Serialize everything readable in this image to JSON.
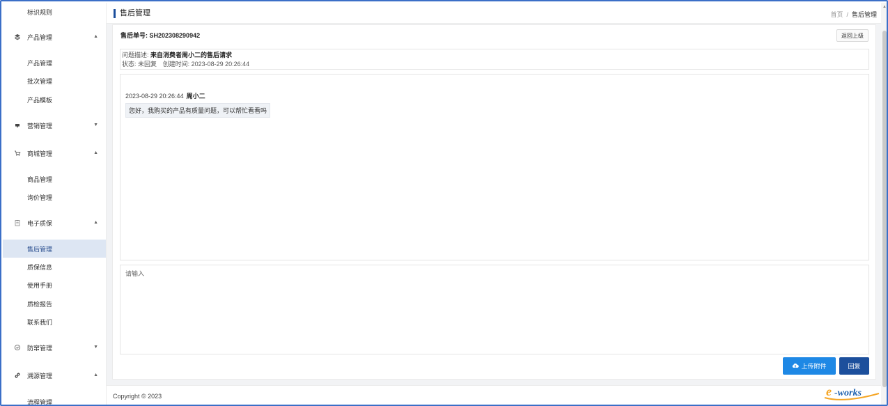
{
  "sidebar": {
    "items": [
      {
        "label": "标识规则",
        "kind": "sub"
      },
      {
        "label": "产品管理",
        "kind": "group",
        "icon": "layers-icon",
        "arrow": "▲"
      },
      {
        "label": "产品管理",
        "kind": "sub"
      },
      {
        "label": "批次管理",
        "kind": "sub"
      },
      {
        "label": "产品模板",
        "kind": "sub"
      },
      {
        "label": "营销管理",
        "kind": "group",
        "icon": "monitor-icon",
        "arrow": "▼"
      },
      {
        "label": "商城管理",
        "kind": "group",
        "icon": "cart-icon",
        "arrow": "▲"
      },
      {
        "label": "商品管理",
        "kind": "sub"
      },
      {
        "label": "询价管理",
        "kind": "sub"
      },
      {
        "label": "电子质保",
        "kind": "group",
        "icon": "clipboard-icon",
        "arrow": "▲"
      },
      {
        "label": "售后管理",
        "kind": "sub",
        "active": true
      },
      {
        "label": "质保信息",
        "kind": "sub"
      },
      {
        "label": "使用手册",
        "kind": "sub"
      },
      {
        "label": "质检报告",
        "kind": "sub"
      },
      {
        "label": "联系我们",
        "kind": "sub"
      },
      {
        "label": "防窜管理",
        "kind": "group",
        "icon": "shield-icon",
        "arrow": "▼"
      },
      {
        "label": "溯源管理",
        "kind": "group",
        "icon": "link-icon",
        "arrow": "▲"
      },
      {
        "label": "流程管理",
        "kind": "sub"
      }
    ]
  },
  "header": {
    "title": "售后管理",
    "breadcrumb": {
      "home": "首页",
      "separator": "/",
      "current": "售后管理"
    }
  },
  "detail": {
    "order_label": "售后单号:",
    "order_no": "SH202308290942",
    "back_label": "返回上级",
    "desc_label": "问题描述:",
    "desc_value": "来自消费者周小二的售后请求",
    "status_label": "状态:",
    "status_value": "未回复",
    "created_label": "创建时间:",
    "created_value": "2023-08-29 20:26:44"
  },
  "messages": [
    {
      "time": "2023-08-29 20:26:44",
      "author": "周小二",
      "text": "您好，我购买的产品有质量问题，可以帮忙看看吗"
    }
  ],
  "reply": {
    "placeholder": "请输入",
    "upload_label": "上传附件",
    "submit_label": "回复"
  },
  "footer": {
    "copyright": "Copyright © 2023"
  },
  "watermark": {
    "text": "e-works"
  },
  "colors": {
    "accent": "#1c4f9c",
    "upload": "#1e88e5",
    "active_bg": "#dde6f3",
    "frame": "#3b6fc7"
  }
}
